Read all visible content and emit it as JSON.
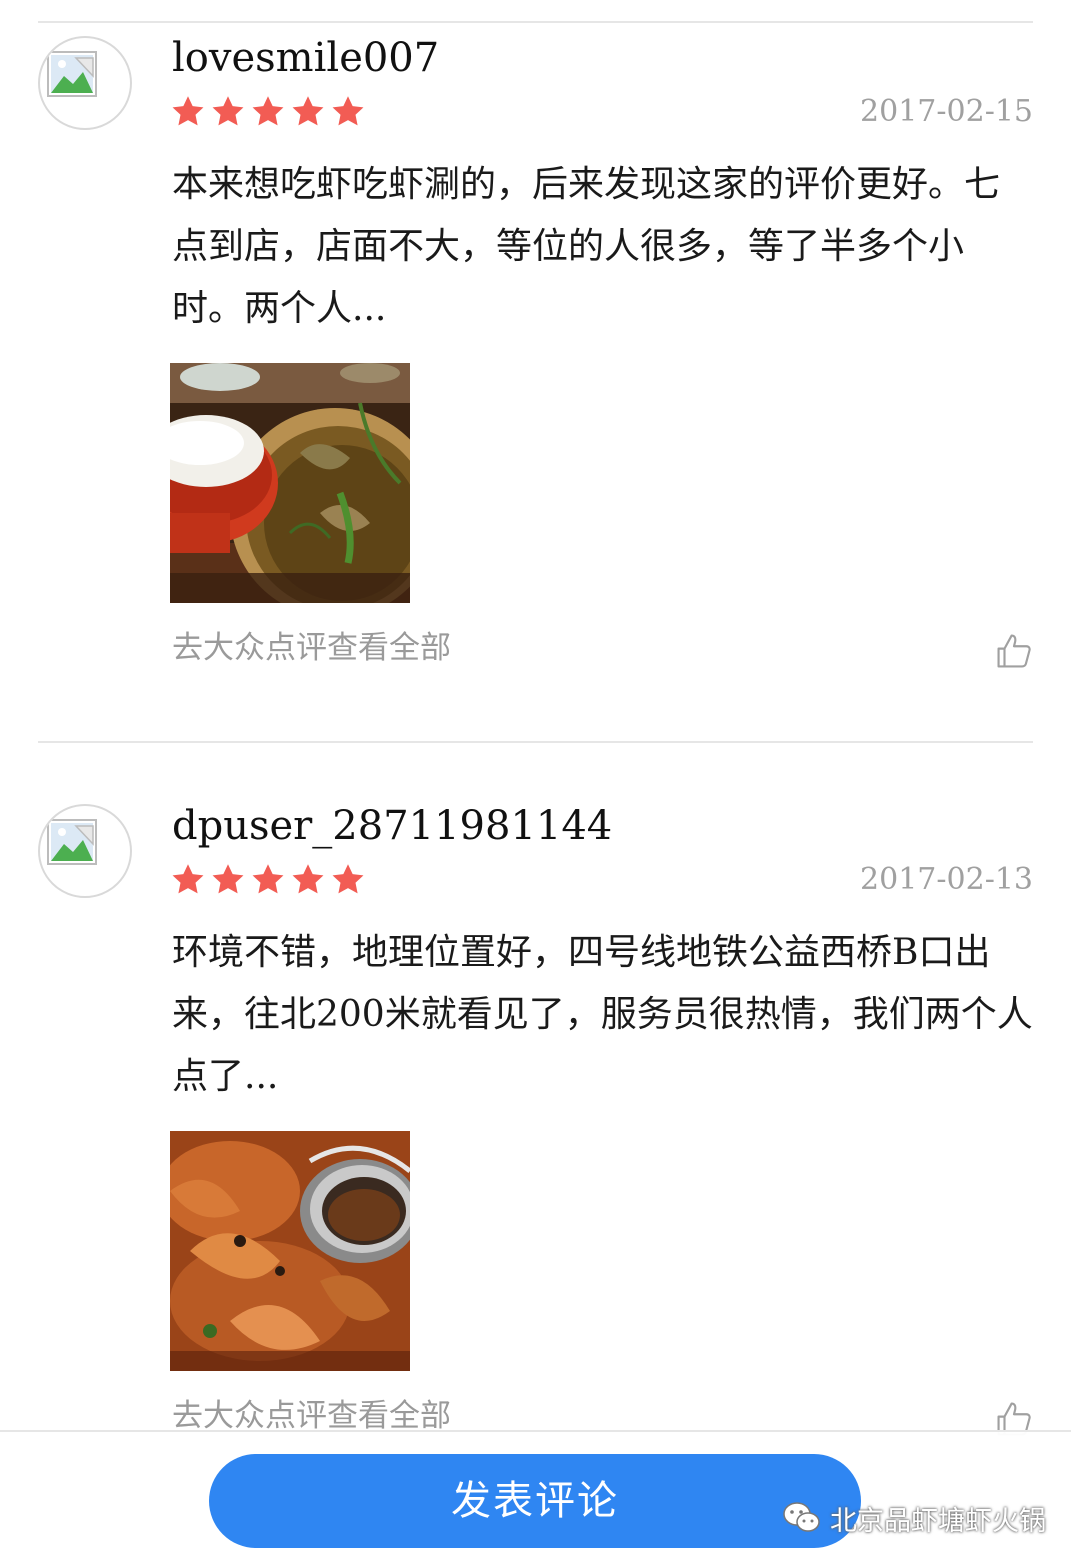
{
  "reviews": [
    {
      "username": "lovesmile007",
      "rating": 5,
      "date": "2017-02-15",
      "text": "本来想吃虾吃虾涮的，后来发现这家的评价更好。七点到店，店面不大，等位的人很多，等了半多个小时。两个人...",
      "photo": "food-photo-rice-and-hotpot",
      "more_link": "去大众点评查看全部",
      "like_icon": "thumbs-up-icon"
    },
    {
      "username": "dpuser_28711981144",
      "rating": 5,
      "date": "2017-02-13",
      "text": "环境不错，地理位置好，四号线地铁公益西桥B口出来，往北200米就看见了，服务员很热情，我们两个人点了...",
      "photo": "food-photo-shrimp-hotpot",
      "more_link": "去大众点评查看全部",
      "like_icon": "thumbs-up-icon"
    }
  ],
  "footer": {
    "post_button_label": "发表评论",
    "watermark": "北京品虾塘虾火锅"
  },
  "colors": {
    "star": "#f25c54",
    "button": "#2f86f2",
    "muted_text": "#9a9a9a",
    "divider": "#e6e6e6"
  }
}
